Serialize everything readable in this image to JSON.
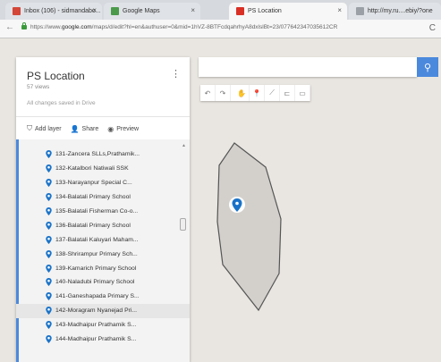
{
  "browser": {
    "tabs": [
      {
        "label": "Inbox (106) - sidmandabo...",
        "favicon_color": "#d44638",
        "active": false
      },
      {
        "label": "Google Maps",
        "favicon_color": "#4a9a4a",
        "active": false
      },
      {
        "label": "PS Location",
        "favicon_color": "#d93025",
        "active": true
      },
      {
        "label": "http://my.ru....ebiy/?one",
        "favicon_color": "#9aa0a6",
        "active": false
      }
    ],
    "url_prefix": "https://www.",
    "url_domain": "google.com",
    "url_rest": "/maps/d/edit?hl=en&authuser=0&mid=1hVZ-8BTFcdqahrhyA8dxlslBt=23/077642347035612CR"
  },
  "panel": {
    "title": "PS Location",
    "views": "57 views",
    "saved_status": "All changes saved in Drive",
    "toolbar": {
      "add_layer": "Add layer",
      "share": "Share",
      "preview": "Preview"
    },
    "items": [
      "131-Zancera SLLs,Prathamik...",
      "132-Katalbori Natiwali SSK",
      "133-Narayanpur Special C...",
      "134-Balatali Primary School",
      "135-Balatali Fisherman Co-o...",
      "136-Balatali Primary School",
      "137-Balatali Kaluyari Maham...",
      "138-Shrirampur Primary Sch...",
      "139-Kamarich Primary School",
      "140-Naladubi Primary School",
      "141-Ganeshapada Primary S...",
      "142-Moragram Nyanejad Pri...",
      "143-Madhaipur Prathamik S...",
      "144-Madhaipur Prathamik S..."
    ],
    "selected_index": 11
  },
  "map": {
    "search_placeholder": "",
    "accent_color": "#4b89dc",
    "polygon_color": "#6e6e6e",
    "marker_color": "#1a73c8"
  },
  "icons": {
    "search": "search-icon",
    "kebab": "more-vert-icon",
    "marker": "location-pin-icon"
  }
}
